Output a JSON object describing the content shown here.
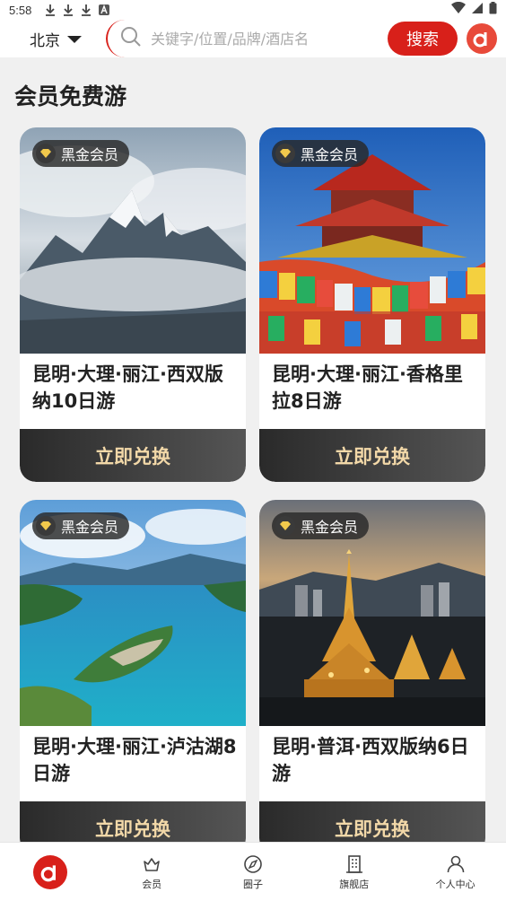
{
  "status_bar": {
    "time": "5:58"
  },
  "header": {
    "city": "北京",
    "search_placeholder": "关键字/位置/品牌/酒店名",
    "search_button": "搜索"
  },
  "section_title": "会员免费游",
  "cards": [
    {
      "badge": "黑金会员",
      "title": "昆明·大理·丽江·西双版纳10日游",
      "button": "立即兑换"
    },
    {
      "badge": "黑金会员",
      "title": "昆明·大理·丽江·香格里拉8日游",
      "button": "立即兑换"
    },
    {
      "badge": "黑金会员",
      "title": "昆明·大理·丽江·泸沽湖8日游",
      "button": "立即兑换"
    },
    {
      "badge": "黑金会员",
      "title": "昆明·普洱·西双版纳6日游",
      "button": "立即兑换"
    }
  ],
  "tabs": [
    {
      "label": "",
      "icon": "home-logo-icon"
    },
    {
      "label": "会员",
      "icon": "crown-icon"
    },
    {
      "label": "圈子",
      "icon": "compass-icon"
    },
    {
      "label": "旗舰店",
      "icon": "building-icon"
    },
    {
      "label": "个人中心",
      "icon": "person-icon"
    }
  ],
  "colors": {
    "brand_red": "#d8201a",
    "button_text": "#f2d8a8"
  }
}
